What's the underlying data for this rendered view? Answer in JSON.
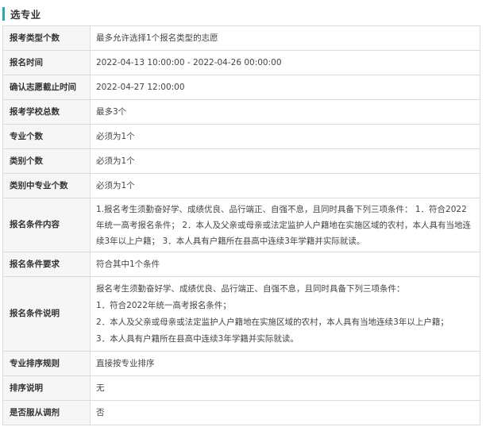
{
  "section": {
    "title": "选专业"
  },
  "rows": [
    {
      "label": "报考类型个数",
      "value": "最多允许选择1个报名类型的志愿"
    },
    {
      "label": "报名时间",
      "value": "2022-04-13 10:00:00 - 2022-04-26 00:00:00"
    },
    {
      "label": "确认志愿截止时间",
      "value": "2022-04-27 12:00:00"
    },
    {
      "label": "报考学校总数",
      "value": "最多3个"
    },
    {
      "label": "专业个数",
      "value": "必须为1个"
    },
    {
      "label": "类别个数",
      "value": "必须为1个"
    },
    {
      "label": "类别中专业个数",
      "value": "必须为1个"
    },
    {
      "label": "报名条件内容",
      "value": "1.报名考生须勤奋好学、成绩优良、品行端正、自强不息，且同时具备下列三项条件： 1．符合2022年统一高考报名条件； 2．本人及父亲或母亲或法定监护人户籍地在实施区域的农村，本人具有当地连续3年以上户籍； 3．本人具有户籍所在县高中连续3年学籍并实际就读。"
    },
    {
      "label": "报名条件要求",
      "value": "符合其中1个条件"
    },
    {
      "label": "报名条件说明",
      "lines": [
        "报名考生须勤奋好学、成绩优良、品行端正、自强不息，且同时具备下列三项条件：",
        "1．符合2022年统一高考报名条件；",
        "2．本人及父亲或母亲或法定监护人户籍地在实施区域的农村，本人具有当地连续3年以上户籍；",
        "3．本人具有户籍所在县高中连续3年学籍并实际就读。"
      ]
    },
    {
      "label": "专业排序规则",
      "value": "直接按专业排序"
    },
    {
      "label": "排序说明",
      "value": "无"
    },
    {
      "label": "是否服从调剂",
      "value": "否"
    }
  ]
}
